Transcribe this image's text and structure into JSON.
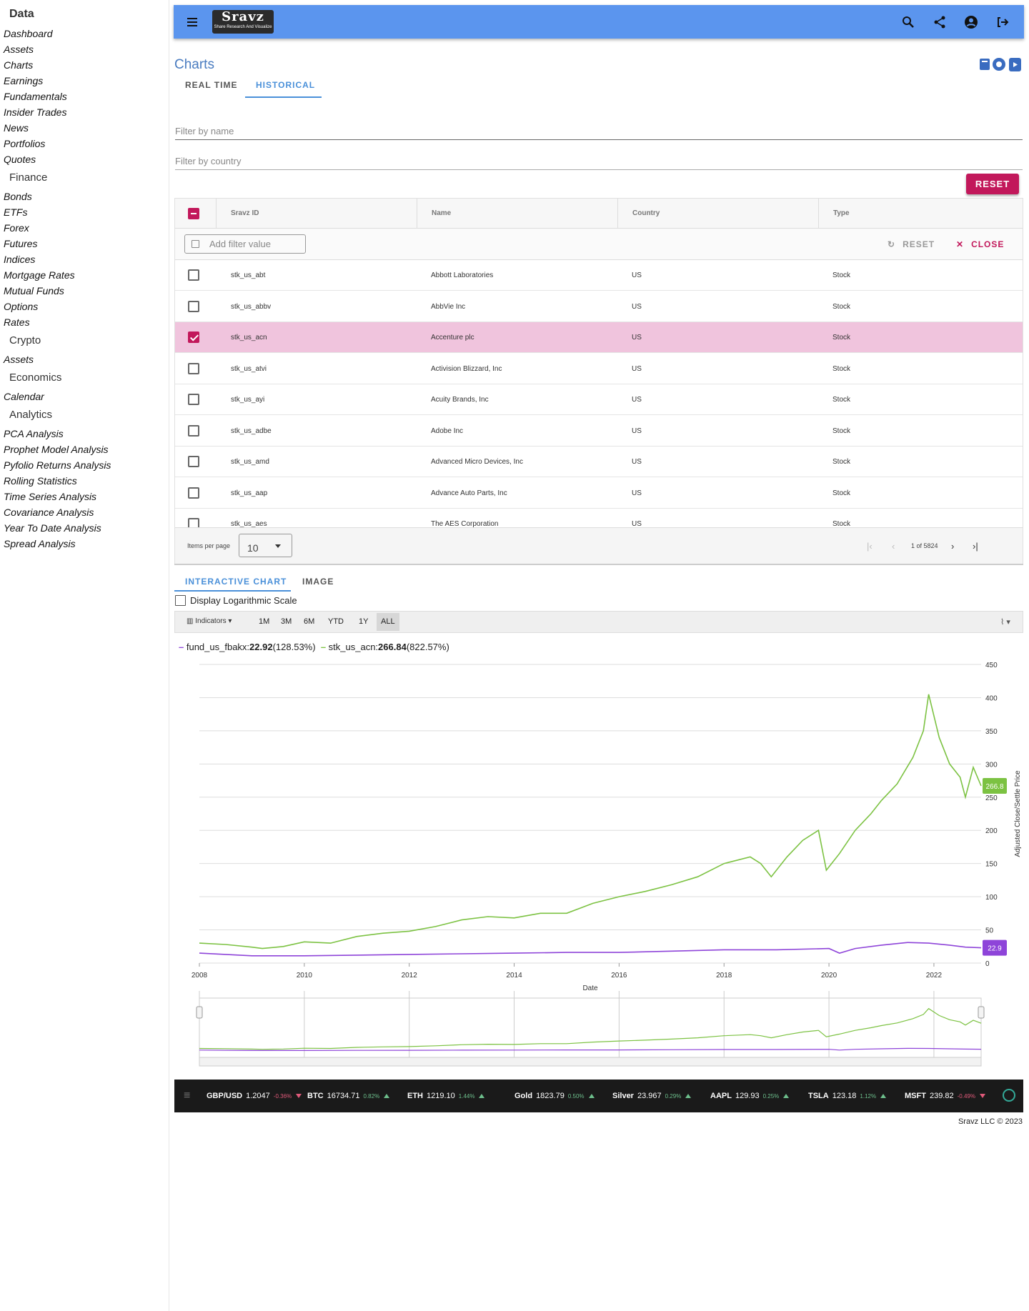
{
  "sidebar": {
    "title": "Data",
    "data_items": [
      "Dashboard",
      "Assets",
      "Charts",
      "Earnings",
      "Fundamentals",
      "Insider Trades",
      "News",
      "Portfolios",
      "Quotes"
    ],
    "finance_title": "Finance",
    "finance_items": [
      "Bonds",
      "ETFs",
      "Forex",
      "Futures",
      "Indices",
      "Mortgage Rates",
      "Mutual Funds",
      "Options",
      "Rates"
    ],
    "crypto_title": "Crypto",
    "crypto_items": [
      "Assets"
    ],
    "economics_title": "Economics",
    "economics_items": [
      "Calendar"
    ],
    "analytics_title": "Analytics",
    "analytics_items": [
      "PCA Analysis",
      "Prophet Model Analysis",
      "Pyfolio Returns Analysis",
      "Rolling Statistics",
      "Time Series Analysis",
      "Covariance Analysis",
      "Year To Date Analysis",
      "Spread Analysis"
    ]
  },
  "topbar": {
    "logo_text": "Sravz",
    "logo_tagline": "Share Research And Visualize",
    "color": "#5b95ee",
    "icons": [
      "menu-icon",
      "search-icon",
      "share-icon",
      "account-icon",
      "logout-icon"
    ]
  },
  "page": {
    "title": "Charts",
    "tabs": [
      "REAL TIME",
      "HISTORICAL"
    ],
    "active_tab": "HISTORICAL",
    "filter_name_placeholder": "Filter by name",
    "filter_country_placeholder": "Filter by country",
    "reset_label": "RESET",
    "header_icons": [
      "book-icon",
      "github-icon",
      "youtube-icon"
    ]
  },
  "grid": {
    "columns": [
      "Sravz ID",
      "Name",
      "Country",
      "Type"
    ],
    "filter_placeholder": "Add filter value",
    "reset_label": "RESET",
    "close_label": "CLOSE",
    "rows": [
      {
        "id": "stk_us_abt",
        "name": "Abbott Laboratories",
        "country": "US",
        "type": "Stock",
        "checked": false
      },
      {
        "id": "stk_us_abbv",
        "name": "AbbVie Inc",
        "country": "US",
        "type": "Stock",
        "checked": false
      },
      {
        "id": "stk_us_acn",
        "name": "Accenture plc",
        "country": "US",
        "type": "Stock",
        "checked": true
      },
      {
        "id": "stk_us_atvi",
        "name": "Activision Blizzard, Inc",
        "country": "US",
        "type": "Stock",
        "checked": false
      },
      {
        "id": "stk_us_ayi",
        "name": "Acuity Brands, Inc",
        "country": "US",
        "type": "Stock",
        "checked": false
      },
      {
        "id": "stk_us_adbe",
        "name": "Adobe Inc",
        "country": "US",
        "type": "Stock",
        "checked": false
      },
      {
        "id": "stk_us_amd",
        "name": "Advanced Micro Devices, Inc",
        "country": "US",
        "type": "Stock",
        "checked": false
      },
      {
        "id": "stk_us_aap",
        "name": "Advance Auto Parts, Inc",
        "country": "US",
        "type": "Stock",
        "checked": false
      },
      {
        "id": "stk_us_aes",
        "name": "The AES Corporation",
        "country": "US",
        "type": "Stock",
        "checked": false
      }
    ],
    "items_per_page_label": "Items per page",
    "items_per_page": "10",
    "page_info": "1 of 5824"
  },
  "chart_tabs": {
    "tabs": [
      "INTERACTIVE CHART",
      "IMAGE"
    ],
    "active": "INTERACTIVE CHART",
    "log_scale_label": "Display Logarithmic Scale"
  },
  "chart_toolbar": {
    "indicators_label": "Indicators",
    "ranges": [
      "1M",
      "3M",
      "6M",
      "YTD",
      "1Y",
      "ALL"
    ],
    "active_range": "ALL"
  },
  "legend": {
    "s1_name": "fund_us_fbakx:",
    "s1_value": "22.92",
    "s1_pct": "(128.53%)",
    "s2_name": "stk_us_acn:",
    "s2_value": "266.84",
    "s2_pct": "(822.57%)"
  },
  "chart_data": {
    "type": "line",
    "xlabel": "Date",
    "ylabel": "Adjusted Close/Settle Price",
    "xlim": [
      2008,
      2022.9
    ],
    "ylim": [
      0,
      450
    ],
    "x_ticks": [
      "2008",
      "2010",
      "2012",
      "2014",
      "2016",
      "2018",
      "2020",
      "2022"
    ],
    "y_ticks": [
      0,
      50,
      100,
      150,
      200,
      250,
      300,
      350,
      400,
      450
    ],
    "grid": true,
    "series": [
      {
        "name": "stk_us_acn",
        "color": "#7cc242",
        "last_label": "266.8",
        "x": [
          2008,
          2008.5,
          2009,
          2009.2,
          2009.6,
          2010,
          2010.5,
          2011,
          2011.5,
          2012,
          2012.5,
          2013,
          2013.5,
          2014,
          2014.5,
          2015,
          2015.5,
          2016,
          2016.5,
          2017,
          2017.5,
          2018,
          2018.5,
          2018.7,
          2018.9,
          2019.2,
          2019.5,
          2019.8,
          2019.95,
          2020.2,
          2020.5,
          2020.8,
          2021,
          2021.3,
          2021.6,
          2021.8,
          2021.9,
          2022.1,
          2022.3,
          2022.5,
          2022.6,
          2022.75,
          2022.9
        ],
        "y": [
          30,
          28,
          24,
          22,
          25,
          32,
          30,
          40,
          45,
          48,
          55,
          65,
          70,
          68,
          75,
          75,
          90,
          100,
          108,
          118,
          130,
          150,
          160,
          150,
          130,
          160,
          185,
          200,
          140,
          165,
          200,
          225,
          245,
          270,
          310,
          350,
          405,
          340,
          300,
          280,
          250,
          295,
          267
        ]
      },
      {
        "name": "fund_us_fbakx",
        "color": "#8e44d9",
        "last_label": "22.9",
        "x": [
          2008,
          2009,
          2010,
          2011,
          2012,
          2013,
          2014,
          2015,
          2016,
          2017,
          2018,
          2019,
          2020,
          2020.2,
          2020.5,
          2021,
          2021.5,
          2021.9,
          2022.3,
          2022.6,
          2022.9
        ],
        "y": [
          15,
          11,
          11,
          12,
          13,
          14,
          15,
          16,
          16,
          18,
          20,
          20,
          22,
          15,
          22,
          27,
          31,
          30,
          27,
          24,
          23
        ]
      }
    ]
  },
  "ticker": [
    {
      "sym": "GBP/USD",
      "val": "1.2047",
      "pct": "-0.36%",
      "dir": "dn"
    },
    {
      "sym": "BTC",
      "val": "16734.71",
      "pct": "0.82%",
      "dir": "up"
    },
    {
      "sym": "ETH",
      "val": "1219.10",
      "pct": "1.44%",
      "dir": "up"
    },
    {
      "sym": "Gold",
      "val": "1823.79",
      "pct": "0.50%",
      "dir": "up"
    },
    {
      "sym": "Silver",
      "val": "23.967",
      "pct": "0.29%",
      "dir": "up"
    },
    {
      "sym": "AAPL",
      "val": "129.93",
      "pct": "0.25%",
      "dir": "up"
    },
    {
      "sym": "TSLA",
      "val": "123.18",
      "pct": "1.12%",
      "dir": "up"
    },
    {
      "sym": "MSFT",
      "val": "239.82",
      "pct": "-0.49%",
      "dir": "dn"
    }
  ],
  "footer": "Sravz LLC © 2023"
}
